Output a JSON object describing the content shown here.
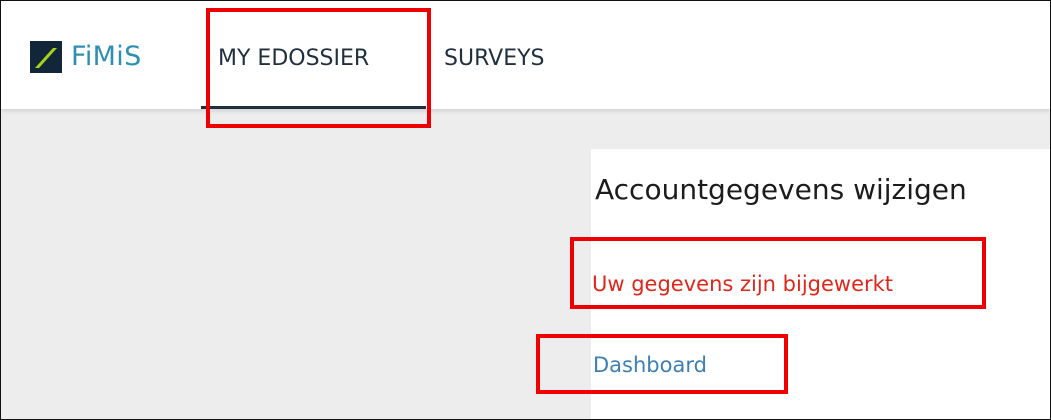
{
  "header": {
    "brand": "FiMiS",
    "brand_color": "#2f8fb3",
    "logo_mark_color": "#a8d21f",
    "logo_bg_color": "#12263a",
    "nav": [
      {
        "label": "MY EDOSSIER",
        "active": true
      },
      {
        "label": "SURVEYS",
        "active": false
      }
    ]
  },
  "main": {
    "title": "Accountgegevens wijzigen",
    "status_message": "Uw gegevens zijn bijgewerkt",
    "status_color": "#e0261a",
    "dashboard_link": "Dashboard",
    "link_color": "#3d7fb3"
  },
  "annotations": {
    "highlight_color": "#ee0000",
    "boxes": [
      "nav-my-edossier",
      "status-message",
      "dashboard-link"
    ]
  }
}
